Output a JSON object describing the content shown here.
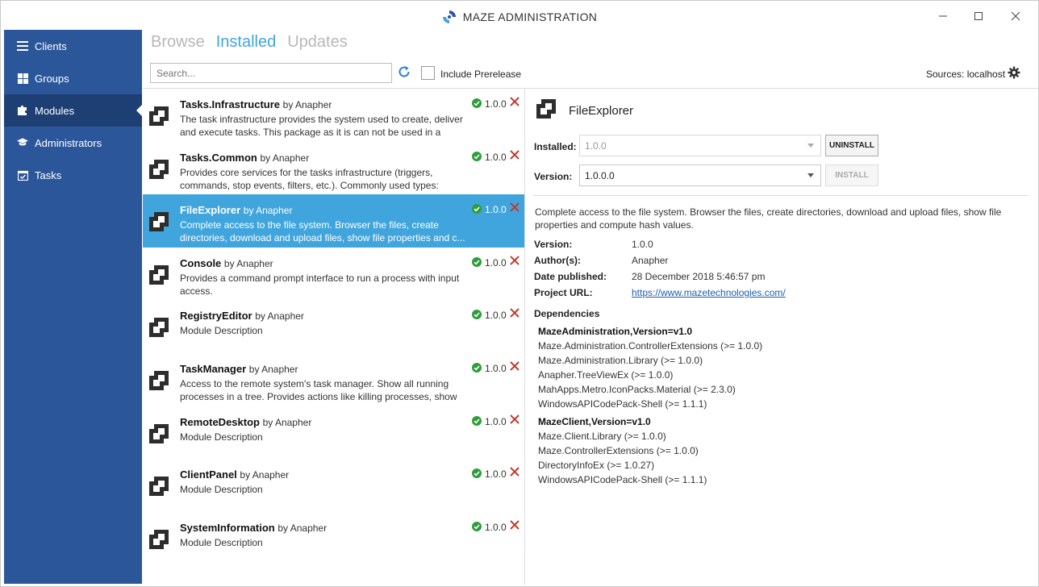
{
  "window": {
    "title": "MAZE ADMINISTRATION",
    "minimize_icon": "minimize-icon",
    "maximize_icon": "maximize-icon",
    "close_icon": "close-icon"
  },
  "sidebar": {
    "items": [
      {
        "label": "Clients",
        "icon": "list-icon"
      },
      {
        "label": "Groups",
        "icon": "grid-icon"
      },
      {
        "label": "Modules",
        "icon": "puzzle-icon",
        "active": true
      },
      {
        "label": "Administrators",
        "icon": "graduation-cap-icon"
      },
      {
        "label": "Tasks",
        "icon": "calendar-check-icon"
      }
    ]
  },
  "tabs": [
    {
      "label": "Browse"
    },
    {
      "label": "Installed",
      "active": true
    },
    {
      "label": "Updates"
    }
  ],
  "toolbar": {
    "search_placeholder": "Search...",
    "include_prerelease": "Include Prerelease",
    "include_prerelease_checked": false,
    "sources_label": "Sources: localhost"
  },
  "packages": [
    {
      "name": "Tasks.Infrastructure",
      "by": "by Anapher",
      "description": "The task infrastructure provides the system used to create, deliver and execute tasks. This package as it is can not be used in a usefu...",
      "version": "1.0.0"
    },
    {
      "name": "Tasks.Common",
      "by": "by Anapher",
      "description": "Provides core services for the tasks infrastructure (triggers, commands, stop events, filters, etc.). Commonly used types: Imme...",
      "version": "1.0.0"
    },
    {
      "name": "FileExplorer",
      "by": "by Anapher",
      "description": "Complete access to the file system. Browser the files, create directories, download and upload files, show file properties and c...",
      "version": "1.0.0",
      "selected": true
    },
    {
      "name": "Console",
      "by": "by Anapher",
      "description": "Provides a command prompt interface to run a process with input access.",
      "version": "1.0.0"
    },
    {
      "name": "RegistryEditor",
      "by": "by Anapher",
      "description": "Module Description",
      "version": "1.0.0"
    },
    {
      "name": "TaskManager",
      "by": "by Anapher",
      "description": "Access to the remote system's task manager. Show all running processes in a tree. Provides actions like killing processes, show p...",
      "version": "1.0.0"
    },
    {
      "name": "RemoteDesktop",
      "by": "by Anapher",
      "description": "Module Description",
      "version": "1.0.0"
    },
    {
      "name": "ClientPanel",
      "by": "by Anapher",
      "description": "Module Description",
      "version": "1.0.0"
    },
    {
      "name": "SystemInformation",
      "by": "by Anapher",
      "description": "Module Description",
      "version": "1.0.0"
    }
  ],
  "details": {
    "title": "FileExplorer",
    "installed_label": "Installed:",
    "installed_value": "1.0.0",
    "uninstall_label": "UNINSTALL",
    "version_label": "Version:",
    "version_value": "1.0.0.0",
    "install_label": "INSTALL",
    "description": "Complete access to the file system. Browser the files, create directories, download and upload files, show file properties and compute hash values.",
    "meta": [
      {
        "key": "Version:",
        "value": "1.0.0"
      },
      {
        "key": "Author(s):",
        "value": "Anapher"
      },
      {
        "key": "Date published:",
        "value": "28 December 2018 5:46:57 pm"
      },
      {
        "key": "Project URL:",
        "value": "https://www.mazetechnologies.com/",
        "link": true
      }
    ],
    "dependencies_title": "Dependencies",
    "dependency_groups": [
      {
        "title": "MazeAdministration,Version=v1.0",
        "items": [
          "Maze.Administration.ControllerExtensions (>= 1.0.0)",
          "Maze.Administration.Library (>= 1.0.0)",
          "Anapher.TreeViewEx (>= 1.0.0)",
          "MahApps.Metro.IconPacks.Material (>= 2.3.0)",
          "WindowsAPICodePack-Shell (>= 1.1.1)"
        ]
      },
      {
        "title": "MazeClient,Version=v1.0",
        "items": [
          "Maze.Client.Library (>= 1.0.0)",
          "Maze.ControllerExtensions (>= 1.0.0)",
          "DirectoryInfoEx (>= 1.0.27)",
          "WindowsAPICodePack-Shell (>= 1.1.1)"
        ]
      }
    ]
  },
  "colors": {
    "sidebar": "#2b579a",
    "sidebar_active": "#1e3f73",
    "accent": "#41a5dd",
    "installed_check": "#2e9d3a",
    "uninstall_x": "#c0392b"
  }
}
